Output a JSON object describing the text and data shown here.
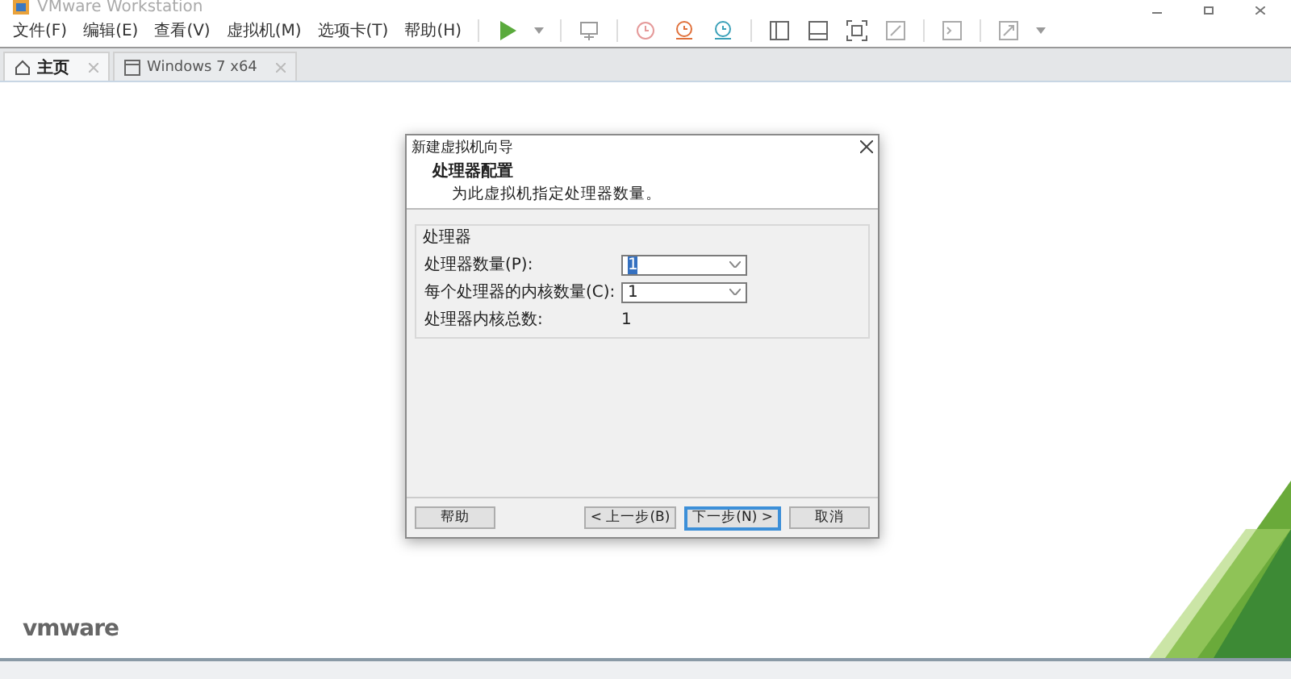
{
  "window": {
    "title": "VMware Workstation"
  },
  "menu": [
    "文件(F)",
    "编辑(E)",
    "查看(V)",
    "虚拟机(M)",
    "选项卡(T)",
    "帮助(H)"
  ],
  "toolbar": [
    {
      "kind": "play"
    },
    {
      "kind": "caret"
    },
    {
      "kind": "sep"
    },
    {
      "kind": "keys"
    },
    {
      "kind": "sep"
    },
    {
      "kind": "clock"
    },
    {
      "kind": "restore"
    },
    {
      "kind": "snapshots"
    },
    {
      "kind": "sep"
    },
    {
      "kind": "sidebar"
    },
    {
      "kind": "thumbs"
    },
    {
      "kind": "fullscreen"
    },
    {
      "kind": "unity"
    },
    {
      "kind": "sep"
    },
    {
      "kind": "console"
    },
    {
      "kind": "sep"
    },
    {
      "kind": "stretch"
    },
    {
      "kind": "caret"
    }
  ],
  "tabs": [
    {
      "label": "主页",
      "kind": "home",
      "selected": true
    },
    {
      "label": "Windows 7 x64",
      "kind": "vm",
      "selected": false
    }
  ],
  "dialog": {
    "title": "新建虚拟机向导",
    "heading": "处理器配置",
    "subtitle": "为此虚拟机指定处理器数量。",
    "group": {
      "title": "处理器",
      "rows": [
        {
          "kind": "combo",
          "label": "处理器数量(P):",
          "value": "1",
          "focused": true
        },
        {
          "kind": "combo",
          "label": "每个处理器的内核数量(C):",
          "value": "1",
          "focused": false
        },
        {
          "kind": "text",
          "label": "处理器内核总数:",
          "value": "1"
        }
      ]
    },
    "buttons": [
      {
        "label": "帮助",
        "default": false
      },
      {
        "label": "< 上一步(B)",
        "default": false
      },
      {
        "label": "下一步(N) >",
        "default": true
      },
      {
        "label": "取消",
        "default": false
      }
    ]
  },
  "brand": "vmware"
}
